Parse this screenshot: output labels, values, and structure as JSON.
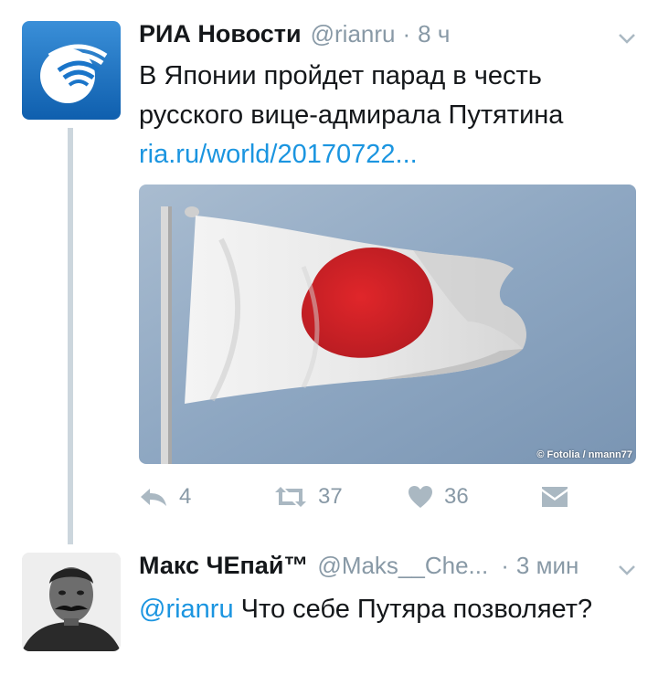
{
  "tweet": {
    "author_name": "РИА Новости",
    "handle": "@rianru",
    "separator": "·",
    "time": "8 ч",
    "text_line1": "В Японии пройдет парад в честь",
    "text_line2": "русского вице-адмирала Путятина",
    "link": "ria.ru/world/20170722...",
    "image_credit": "© Fotolia / nmann77",
    "reply_count": "4",
    "retweet_count": "37",
    "like_count": "36"
  },
  "reply": {
    "author_name": "Макс ЧЕпай™",
    "handle": "@Maks__Che...",
    "separator": "·",
    "time": "3 мин",
    "mention": "@rianru",
    "text": "Что себе Путяра позволяет?"
  },
  "colors": {
    "link": "#1b95e0",
    "muted": "#8899a6",
    "ria_blue": "#1a75c9",
    "thread_line": "#ccd6dd"
  }
}
